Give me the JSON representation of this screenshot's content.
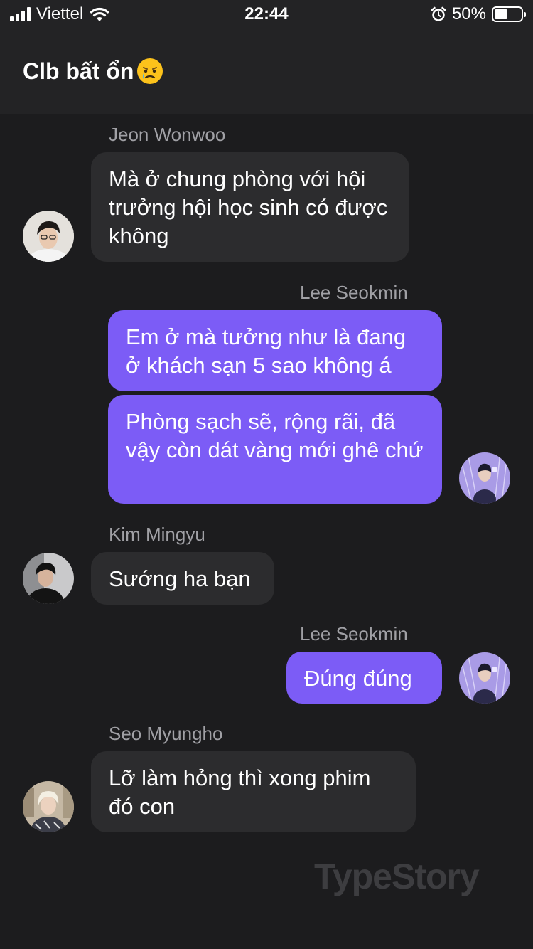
{
  "status_bar": {
    "carrier": "Viettel",
    "time": "22:44",
    "battery_percent": "50%",
    "battery_level": 0.5,
    "icons": [
      "signal-icon",
      "wifi-icon",
      "alarm-icon",
      "battery-icon"
    ]
  },
  "header": {
    "title": "Clb bất ổn",
    "emoji": "crying-face-emoji"
  },
  "messages": [
    {
      "sender": "Jeon Wonwoo",
      "direction": "incoming",
      "bubbles": [
        "Mà ở chung phòng với hội trưởng hội học sinh có được không"
      ]
    },
    {
      "sender": "Lee Seokmin",
      "direction": "outgoing",
      "bubbles": [
        "Em ở mà tưởng như là đang ở khách sạn 5 sao không á",
        "Phòng sạch sẽ, rộng rãi, đã vậy còn dát vàng mới ghê chứ"
      ]
    },
    {
      "sender": "Kim Mingyu",
      "direction": "incoming",
      "bubbles": [
        "Sướng ha bạn"
      ]
    },
    {
      "sender": "Lee Seokmin",
      "direction": "outgoing",
      "bubbles": [
        "Đúng đúng"
      ]
    },
    {
      "sender": "Seo Myungho",
      "direction": "incoming",
      "bubbles": [
        "Lỡ làm hỏng thì xong phim đó con"
      ]
    }
  ],
  "watermark": "TypeStory",
  "colors": {
    "background": "#1c1c1e",
    "header": "#232325",
    "incoming_bubble": "#2c2c2e",
    "outgoing_bubble": "#7c5cf6",
    "sender_name": "#a0a0a5"
  }
}
